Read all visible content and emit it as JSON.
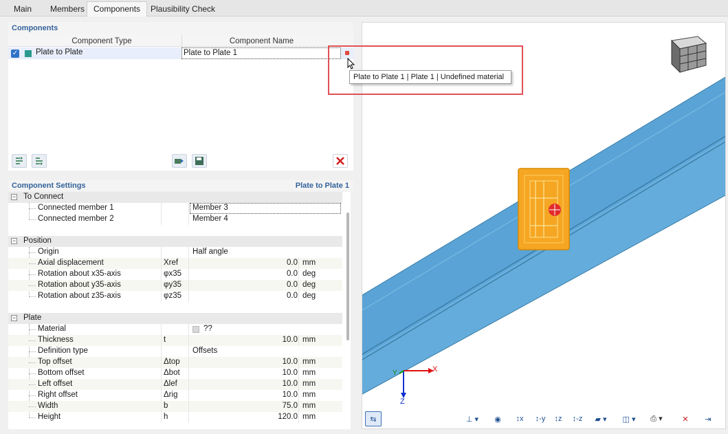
{
  "tabs": [
    "Main",
    "Members",
    "Components",
    "Plausibility Check"
  ],
  "active_tab": "Components",
  "components": {
    "title": "Components",
    "columns": [
      "Component Type",
      "Component Name"
    ],
    "rows": [
      {
        "type": "Plate to Plate",
        "name": "Plate to Plate 1",
        "checked": true
      }
    ]
  },
  "tooltip": "Plate to Plate 1 | Plate 1 | Undefined material",
  "settings": {
    "title": "Component Settings",
    "subject": "Plate to Plate 1",
    "sections": [
      {
        "label": "To Connect"
      },
      {
        "label": "Position"
      },
      {
        "label": "Plate"
      }
    ],
    "to_connect": [
      {
        "name": "Connected member 1",
        "value": "Member 3"
      },
      {
        "name": "Connected member 2",
        "value": "Member 4"
      }
    ],
    "position": [
      {
        "name": "Origin",
        "sym": "",
        "value": "Half angle",
        "num": "",
        "unit": ""
      },
      {
        "name": "Axial displacement",
        "sym": "Xref",
        "value": "",
        "num": "0.0",
        "unit": "mm"
      },
      {
        "name": "Rotation about x35-axis",
        "sym": "φx35",
        "value": "",
        "num": "0.0",
        "unit": "deg"
      },
      {
        "name": "Rotation about y35-axis",
        "sym": "φy35",
        "value": "",
        "num": "0.0",
        "unit": "deg"
      },
      {
        "name": "Rotation about z35-axis",
        "sym": "φz35",
        "value": "",
        "num": "0.0",
        "unit": "deg"
      }
    ],
    "plate": [
      {
        "name": "Material",
        "sym": "",
        "value": "??",
        "num": "",
        "unit": ""
      },
      {
        "name": "Thickness",
        "sym": "t",
        "value": "",
        "num": "10.0",
        "unit": "mm"
      },
      {
        "name": "Definition type",
        "sym": "",
        "value": "Offsets",
        "num": "",
        "unit": ""
      },
      {
        "name": "Top offset",
        "sym": "Δtop",
        "value": "",
        "num": "10.0",
        "unit": "mm"
      },
      {
        "name": "Bottom offset",
        "sym": "Δbot",
        "value": "",
        "num": "10.0",
        "unit": "mm"
      },
      {
        "name": "Left offset",
        "sym": "Δlef",
        "value": "",
        "num": "10.0",
        "unit": "mm"
      },
      {
        "name": "Right offset",
        "sym": "Δrig",
        "value": "",
        "num": "10.0",
        "unit": "mm"
      },
      {
        "name": "Width",
        "sym": "b",
        "value": "",
        "num": "75.0",
        "unit": "mm"
      },
      {
        "name": "Height",
        "sym": "h",
        "value": "",
        "num": "120.0",
        "unit": "mm"
      }
    ]
  },
  "axes": {
    "x": "X",
    "y": "Y",
    "z": "Z"
  },
  "colors": {
    "beam": "#5fa8d8",
    "plate": "#f5a623",
    "accent": "#34639a",
    "tooltip_frame": "#e05055"
  }
}
